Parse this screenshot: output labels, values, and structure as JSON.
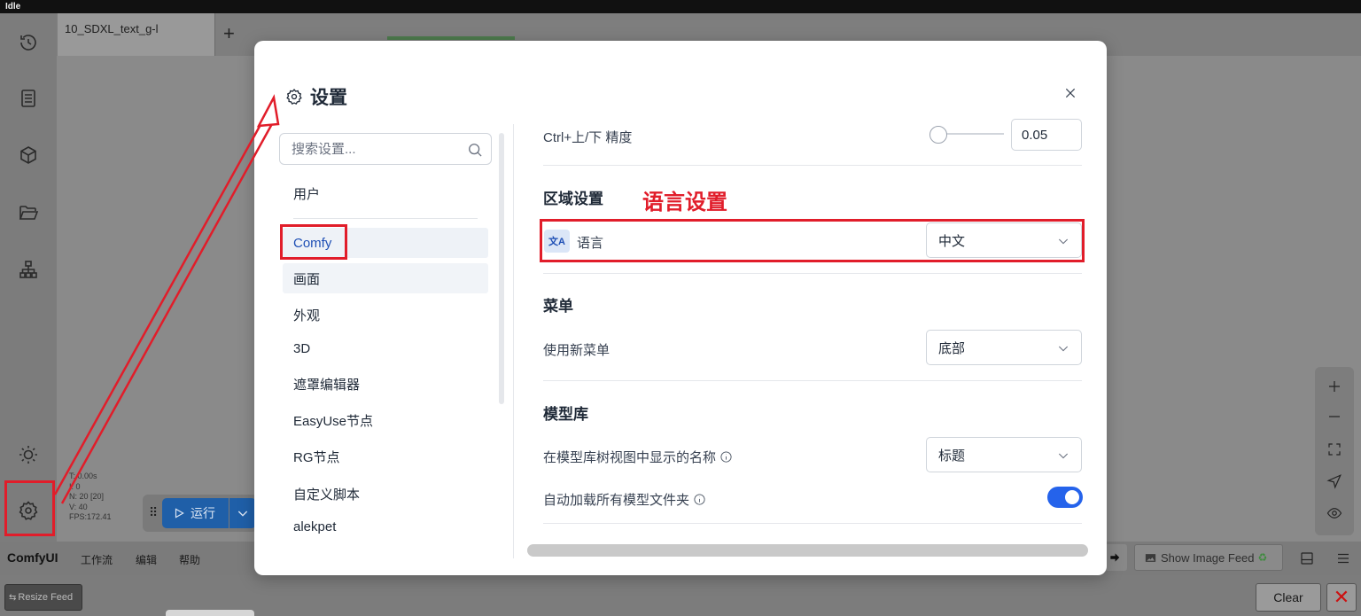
{
  "status": {
    "label": "Idle"
  },
  "tabs": [
    {
      "label": "10_SDXL_text_g-l"
    }
  ],
  "tab_add_label": "+",
  "stats": [
    "T: 0.00s",
    "I: 0",
    "N: 20 [20]",
    "V: 40",
    "FPS:172.41"
  ],
  "run_button": {
    "label": "运行"
  },
  "menubar": {
    "brand": "ComfyUI",
    "items": [
      "工作流",
      "编辑",
      "帮助"
    ],
    "show_image_feed": "Show Image Feed"
  },
  "feedbar": {
    "resize_label": "Resize Feed",
    "clear_label": "Clear",
    "close_label": "✕"
  },
  "dialog": {
    "title": "设置",
    "search_placeholder": "搜索设置...",
    "categories": [
      "用户",
      "Comfy",
      "画面",
      "外观",
      "3D",
      "遮罩编辑器",
      "EasyUse节点",
      "RG节点",
      "自定义脚本",
      "alekpet"
    ],
    "active_category": "Comfy",
    "settings": {
      "ctrl_precision": {
        "label": "Ctrl+上/下 精度",
        "value": "0.05",
        "slider_level": 0.0
      },
      "region_section": "区域设置",
      "language": {
        "badge": "文A",
        "label": "语言",
        "value": "中文"
      },
      "menu_section": "菜单",
      "new_menu": {
        "label": "使用新菜单",
        "value": "底部"
      },
      "model_lib_section": "模型库",
      "model_name_display": {
        "label": "在模型库树视图中显示的名称",
        "value": "标题"
      },
      "auto_load_folders": {
        "label": "自动加载所有模型文件夹",
        "enabled": true
      }
    }
  },
  "annotation": {
    "text": "语言设置",
    "color": "#e11d2a"
  },
  "colors": {
    "accent": "#2563eb",
    "run": "#1f5fa8",
    "annotation": "#e11d2a"
  }
}
